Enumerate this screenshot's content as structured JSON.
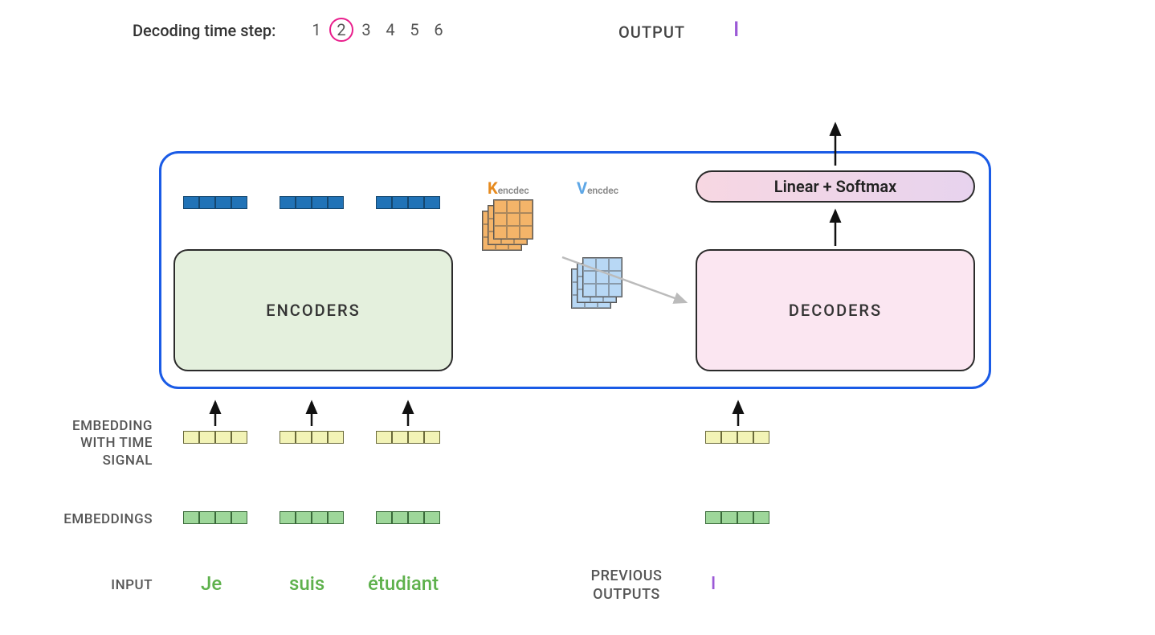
{
  "header": {
    "timestep_label": "Decoding time step:",
    "timesteps": [
      "1",
      "2",
      "3",
      "4",
      "5",
      "6"
    ],
    "current_timestep_index": 1,
    "output_label": "OUTPUT",
    "output_token": "I"
  },
  "kv": {
    "k_letter": "K",
    "k_sub": "encdec",
    "v_letter": "V",
    "v_sub": "encdec"
  },
  "boxes": {
    "encoders": "ENCODERS",
    "decoders": "DECODERS",
    "linear_softmax": "Linear + Softmax"
  },
  "sidelabels": {
    "embedding_time_signal": "EMBEDDING\nWITH TIME\nSIGNAL",
    "embeddings": "EMBEDDINGS",
    "input": "INPUT",
    "previous_outputs": "PREVIOUS\nOUTPUTS"
  },
  "inputs": {
    "words": [
      "Je",
      "suis",
      "étudiant"
    ]
  },
  "previous_output_token": "I",
  "colors": {
    "circle": "#e91e8c",
    "main_border": "#1a5be6",
    "encoder_fill": "#e4f0dd",
    "decoder_fill": "#fbe6f1",
    "token_purple": "#9b59d6",
    "input_green": "#5eb14c"
  }
}
